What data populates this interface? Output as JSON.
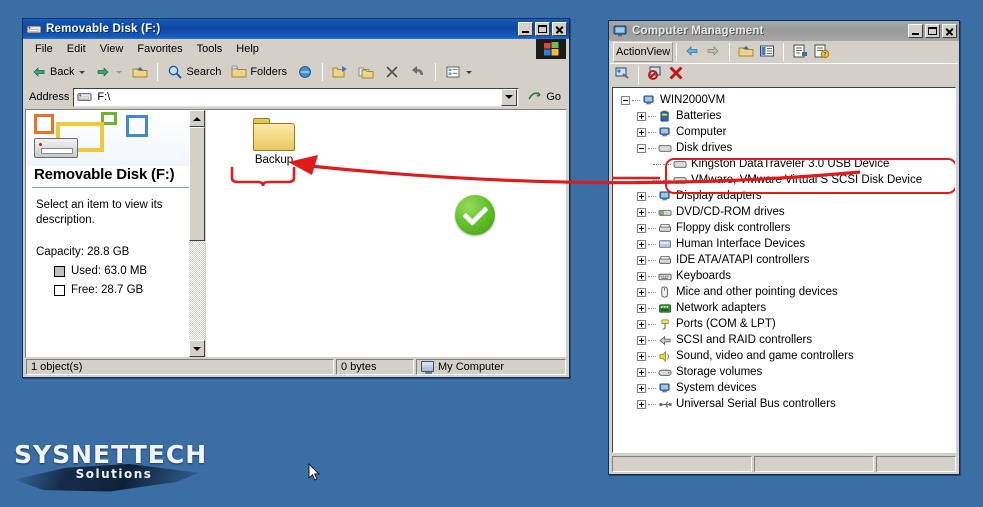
{
  "desktop": {
    "background_color": "#3b6ea5"
  },
  "watermark": {
    "brand": "SYSNETTECH",
    "tagline": "Solutions"
  },
  "explorer": {
    "title": "Removable Disk (F:)",
    "title_icon": "removable-disk-icon",
    "window_buttons": {
      "minimize": "Minimize",
      "maximize": "Maximize",
      "close": "Close"
    },
    "menu": [
      {
        "label": "File"
      },
      {
        "label": "Edit"
      },
      {
        "label": "View"
      },
      {
        "label": "Favorites"
      },
      {
        "label": "Tools"
      },
      {
        "label": "Help"
      }
    ],
    "menu_logo": "windows-flag-icon",
    "toolbar": [
      {
        "name": "back-button",
        "label": "Back",
        "icon": "arrow-left-icon",
        "has_dropdown": true
      },
      {
        "name": "forward-button",
        "label": "",
        "icon": "arrow-right-icon",
        "has_dropdown": true
      },
      {
        "name": "up-button",
        "label": "",
        "icon": "folder-up-icon"
      },
      {
        "name": "search-button",
        "label": "Search",
        "icon": "search-icon"
      },
      {
        "name": "folders-button",
        "label": "Folders",
        "icon": "folders-icon"
      },
      {
        "name": "history-button",
        "label": "",
        "icon": "history-globe-icon"
      },
      {
        "name": "move-to-button",
        "label": "",
        "icon": "move-to-folder-icon"
      },
      {
        "name": "copy-to-button",
        "label": "",
        "icon": "copy-to-folder-icon"
      },
      {
        "name": "delete-button",
        "label": "",
        "icon": "delete-x-icon"
      },
      {
        "name": "undo-button",
        "label": "",
        "icon": "undo-icon"
      },
      {
        "name": "views-button",
        "label": "",
        "icon": "views-icon",
        "has_dropdown": true
      }
    ],
    "address": {
      "label": "Address",
      "icon": "removable-disk-icon",
      "value": "F:\\",
      "placeholder": "",
      "dropdown_icon": "chevron-down-icon",
      "go_label": "Go",
      "go_icon": "go-arrow-icon"
    },
    "task_pane": {
      "heading": "Removable Disk (F:)",
      "description": "Select an item to view its description.",
      "capacity_label": "Capacity: 28.8 GB",
      "used_label": "Used: 63.0 MB",
      "free_label": "Free: 28.7 GB"
    },
    "items": [
      {
        "name": "Backup",
        "icon": "folder-icon"
      }
    ],
    "status": {
      "objects": "1 object(s)",
      "size": "0 bytes",
      "location": "My Computer",
      "location_icon": "my-computer-icon"
    }
  },
  "computer_management": {
    "title": "Computer Management",
    "title_icon": "computer-management-icon",
    "window_buttons": {
      "minimize": "Minimize",
      "maximize": "Maximize",
      "close": "Close"
    },
    "menu": [
      {
        "label": "Action"
      },
      {
        "label": "View"
      }
    ],
    "toolbar": [
      {
        "name": "back-button",
        "icon": "arrow-left-icon"
      },
      {
        "name": "forward-button",
        "icon": "arrow-right-icon"
      },
      {
        "name": "up-one-level-button",
        "icon": "folder-up-icon"
      },
      {
        "name": "show-hide-console-tree-button",
        "icon": "console-tree-icon"
      },
      {
        "name": "properties-button",
        "icon": "properties-icon"
      },
      {
        "name": "help-button",
        "icon": "help-icon"
      }
    ],
    "toolbar2": [
      {
        "name": "scan-for-hardware-changes-button",
        "icon": "scan-hardware-icon"
      },
      {
        "name": "uninstall-button",
        "icon": "uninstall-device-icon"
      },
      {
        "name": "disable-button",
        "icon": "disable-device-icon"
      }
    ],
    "tree": [
      {
        "label": "WIN2000VM",
        "level": 0,
        "expander": "minus",
        "icon": "computer-icon"
      },
      {
        "label": "Batteries",
        "level": 1,
        "expander": "plus",
        "icon": "battery-icon"
      },
      {
        "label": "Computer",
        "level": 1,
        "expander": "plus",
        "icon": "computer-icon"
      },
      {
        "label": "Disk drives",
        "level": 1,
        "expander": "minus",
        "icon": "disk-drive-icon"
      },
      {
        "label": "Kingston DataTraveler 3.0 USB Device",
        "level": 2,
        "expander": "none",
        "icon": "disk-drive-icon",
        "highlighted": true
      },
      {
        "label": "VMware, VMware Virtual S SCSI Disk Device",
        "level": 2,
        "expander": "none",
        "icon": "disk-drive-icon",
        "highlighted": true
      },
      {
        "label": "Display adapters",
        "level": 1,
        "expander": "plus",
        "icon": "display-adapter-icon"
      },
      {
        "label": "DVD/CD-ROM drives",
        "level": 1,
        "expander": "plus",
        "icon": "dvd-drive-icon"
      },
      {
        "label": "Floppy disk controllers",
        "level": 1,
        "expander": "plus",
        "icon": "controller-icon"
      },
      {
        "label": "Human Interface Devices",
        "level": 1,
        "expander": "plus",
        "icon": "hid-icon"
      },
      {
        "label": "IDE ATA/ATAPI controllers",
        "level": 1,
        "expander": "plus",
        "icon": "controller-icon"
      },
      {
        "label": "Keyboards",
        "level": 1,
        "expander": "plus",
        "icon": "keyboard-icon"
      },
      {
        "label": "Mice and other pointing devices",
        "level": 1,
        "expander": "plus",
        "icon": "mouse-icon"
      },
      {
        "label": "Network adapters",
        "level": 1,
        "expander": "plus",
        "icon": "network-adapter-icon"
      },
      {
        "label": "Ports (COM & LPT)",
        "level": 1,
        "expander": "plus",
        "icon": "port-icon"
      },
      {
        "label": "SCSI and RAID controllers",
        "level": 1,
        "expander": "plus",
        "icon": "scsi-icon"
      },
      {
        "label": "Sound, video and game controllers",
        "level": 1,
        "expander": "plus",
        "icon": "speaker-icon"
      },
      {
        "label": "Storage volumes",
        "level": 1,
        "expander": "plus",
        "icon": "storage-volume-icon"
      },
      {
        "label": "System devices",
        "level": 1,
        "expander": "plus",
        "icon": "computer-icon"
      },
      {
        "label": "Universal Serial Bus controllers",
        "level": 1,
        "expander": "plus",
        "icon": "usb-icon"
      }
    ],
    "status": {
      "pane1": "",
      "pane2": "",
      "pane3": ""
    }
  },
  "annotations": {
    "highlight_color": "#e01b1b",
    "success_badge": "check-mark-icon",
    "arrow": "red-arrow-pointing-left",
    "brace": "red-brace-under-backup-folder"
  }
}
